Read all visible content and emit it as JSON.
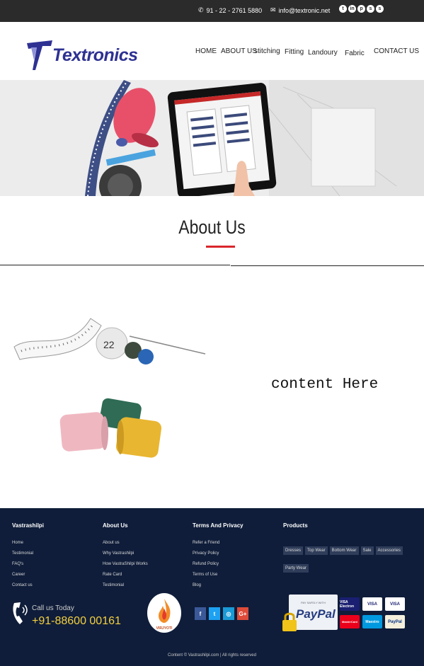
{
  "topbar": {
    "phone": "91 - 22 - 2761 5880",
    "email": "info@textronic.net",
    "socials": [
      "twitter-icon",
      "linkedin-icon",
      "pinterest-icon",
      "skype-icon",
      "skype-alt-icon"
    ]
  },
  "brand": {
    "name": "Textronics"
  },
  "nav": {
    "home": "HOME",
    "about": "ABOUT US",
    "stitching": "stitching",
    "fitting": "Fitting",
    "landoury": "Landoury",
    "fabric": "Fabric",
    "contact": "CONTACT US"
  },
  "about": {
    "title": "About Us",
    "content": "content Here"
  },
  "footer": {
    "col1": {
      "title": "Vastrashilpi",
      "items": [
        "Home",
        "Testimonial",
        "FAQ's",
        "Career",
        "Contact us"
      ]
    },
    "col2": {
      "title": "About Us",
      "items": [
        "About us",
        "Why Vastrashilpi",
        "How VastraShilpi Works",
        "Rate Card",
        "Testimonial"
      ]
    },
    "col3": {
      "title": "Terms And Privacy",
      "items": [
        "Refer a Friend",
        "Privacy Policy",
        "Refund Policy",
        "Terms of Use",
        "Blog"
      ]
    },
    "col4": {
      "title": "Products",
      "tags": [
        "Dresses",
        "Top Wear",
        "Bottom Wear",
        "Sale",
        "Accessories",
        "Party Wear"
      ]
    },
    "call_label": "Call us Today",
    "call_number": "+91-88600 00161",
    "badge_text": "VIRJYOTI",
    "social": [
      {
        "label": "f",
        "color": "#3b5998"
      },
      {
        "label": "t",
        "color": "#1da1f2"
      },
      {
        "label": "◎",
        "color": "#1a9ad6"
      },
      {
        "label": "G+",
        "color": "#dd4b39"
      }
    ],
    "paypal": {
      "top": "PAY SAFELY WITH",
      "name": "PayPal"
    },
    "cards": [
      {
        "label": "VISA Electron",
        "color": "#1a1f71"
      },
      {
        "label": "VISA",
        "color": "#1a1f71"
      },
      {
        "label": "VISA",
        "color": "#1a1f71"
      },
      {
        "label": "MasterCard",
        "color": "#eb001b"
      },
      {
        "label": "Maestro",
        "color": "#0099df"
      },
      {
        "label": "PayPal",
        "color": "#003087"
      }
    ],
    "copyright": "Content © Vastrashilpi.com | All rights reserved"
  }
}
